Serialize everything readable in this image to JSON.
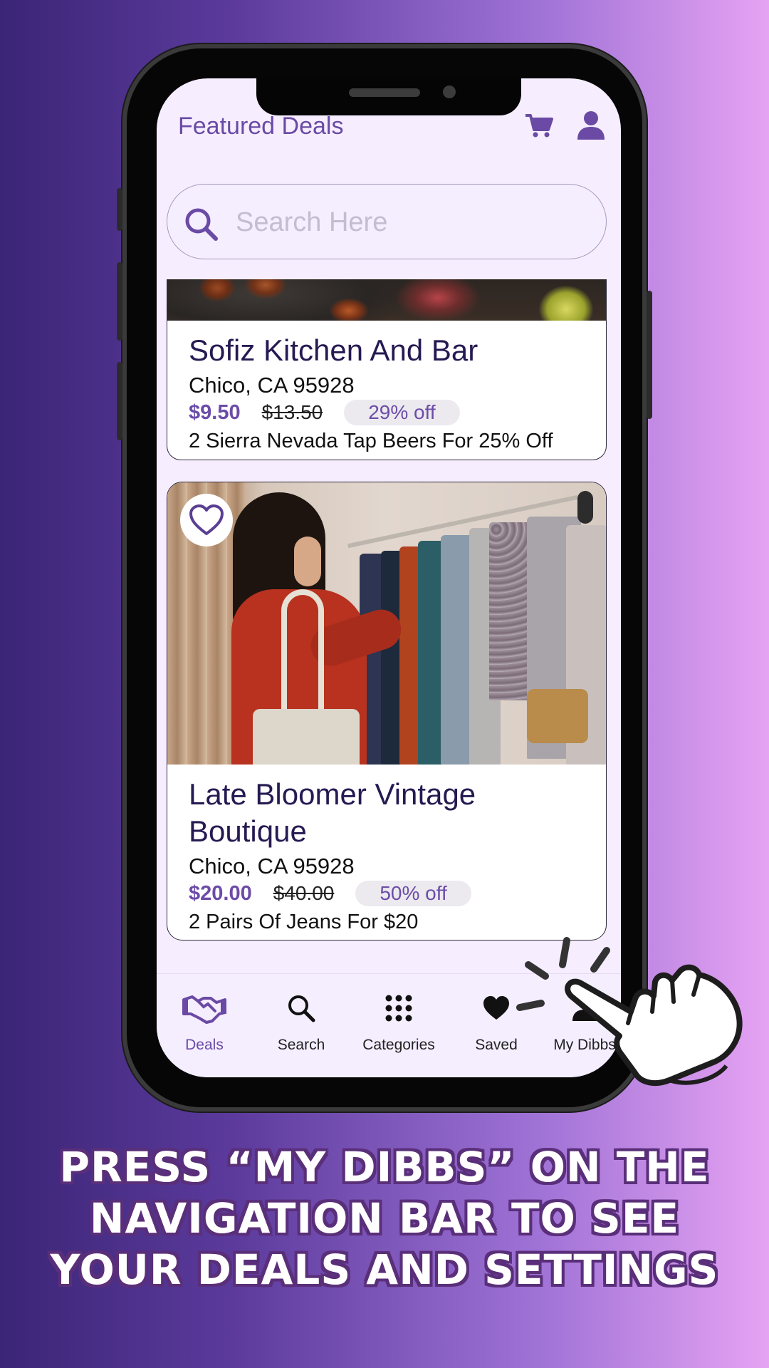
{
  "header": {
    "title": "Featured Deals",
    "cart_icon": "cart-icon",
    "profile_icon": "profile-icon"
  },
  "search": {
    "placeholder": "Search Here",
    "value": ""
  },
  "deals": [
    {
      "name": "Sofiz Kitchen And Bar",
      "location": "Chico, CA 95928",
      "price": "$9.50",
      "original_price": "$13.50",
      "discount": "29% off",
      "description": "2 Sierra Nevada Tap Beers For 25% Off"
    },
    {
      "name_line1": "Late Bloomer Vintage",
      "name_line2": "Boutique",
      "location": "Chico, CA 95928",
      "price": "$20.00",
      "original_price": "$40.00",
      "discount": "50% off",
      "description": "2 Pairs Of Jeans For $20"
    }
  ],
  "nav": {
    "items": [
      {
        "label": "Deals",
        "icon": "handshake-icon",
        "active": true
      },
      {
        "label": "Search",
        "icon": "search-icon",
        "active": false
      },
      {
        "label": "Categories",
        "icon": "grid-icon",
        "active": false
      },
      {
        "label": "Saved",
        "icon": "heart-icon",
        "active": false
      },
      {
        "label": "My Dibbs",
        "icon": "user-icon",
        "active": false
      }
    ]
  },
  "caption": {
    "line1": "PRESS “MY DIBBS” ON THE",
    "line2": "NAVIGATION BAR TO SEE",
    "line3": "YOUR DEALS AND SETTINGS"
  },
  "colors": {
    "accent": "#6a4aa4",
    "screen_bg": "#f6eeff",
    "title_text": "#261a52",
    "bg_gradient_start": "#3b2576",
    "bg_gradient_end": "#e6a3f3"
  }
}
